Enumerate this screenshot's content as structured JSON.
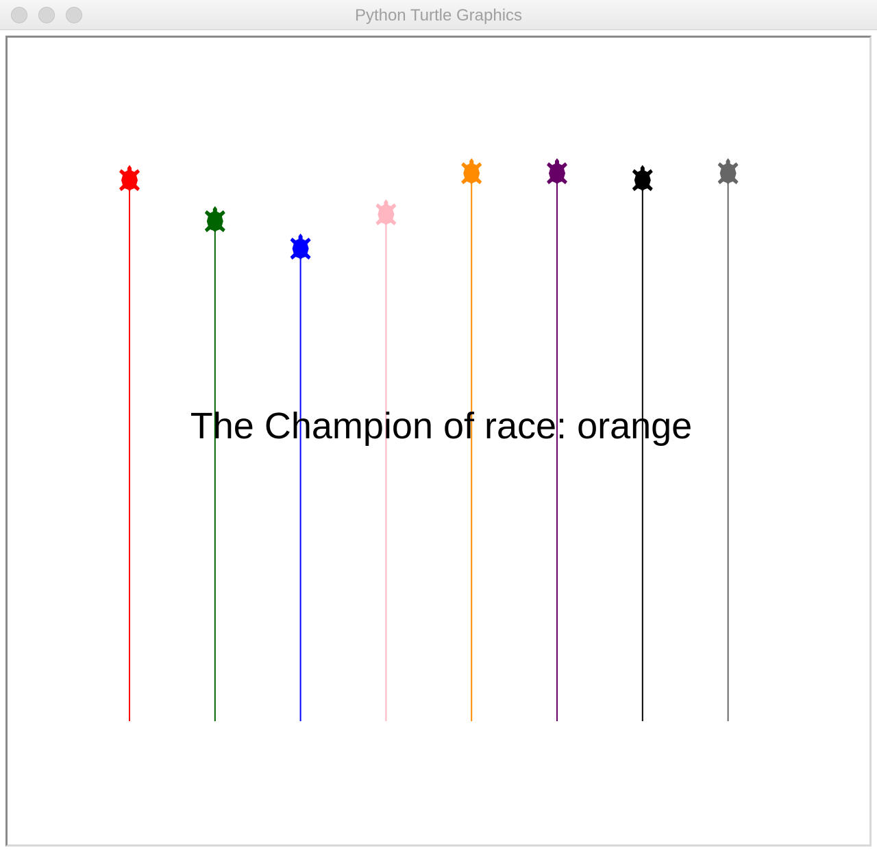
{
  "window": {
    "title": "Python Turtle Graphics",
    "buttons": [
      "close",
      "minimize",
      "zoom"
    ]
  },
  "canvas": {
    "background": "#ffffff",
    "message": "The Champion of race: orange"
  },
  "turtles": [
    {
      "color": "red",
      "hex": "#ff0000",
      "progress": 0.79,
      "icon": "turtle-icon"
    },
    {
      "color": "green",
      "hex": "#006400",
      "progress": 0.73,
      "icon": "turtle-icon"
    },
    {
      "color": "blue",
      "hex": "#0000ff",
      "progress": 0.69,
      "icon": "turtle-icon"
    },
    {
      "color": "pink",
      "hex": "#ffb6c1",
      "progress": 0.74,
      "icon": "turtle-icon"
    },
    {
      "color": "orange",
      "hex": "#ff8c00",
      "progress": 0.8,
      "icon": "turtle-icon"
    },
    {
      "color": "purple",
      "hex": "#660066",
      "progress": 0.8,
      "icon": "turtle-icon"
    },
    {
      "color": "black",
      "hex": "#000000",
      "progress": 0.79,
      "icon": "turtle-icon"
    },
    {
      "color": "gray",
      "hex": "#666666",
      "progress": 0.8,
      "icon": "turtle-icon"
    }
  ],
  "winner": "orange"
}
